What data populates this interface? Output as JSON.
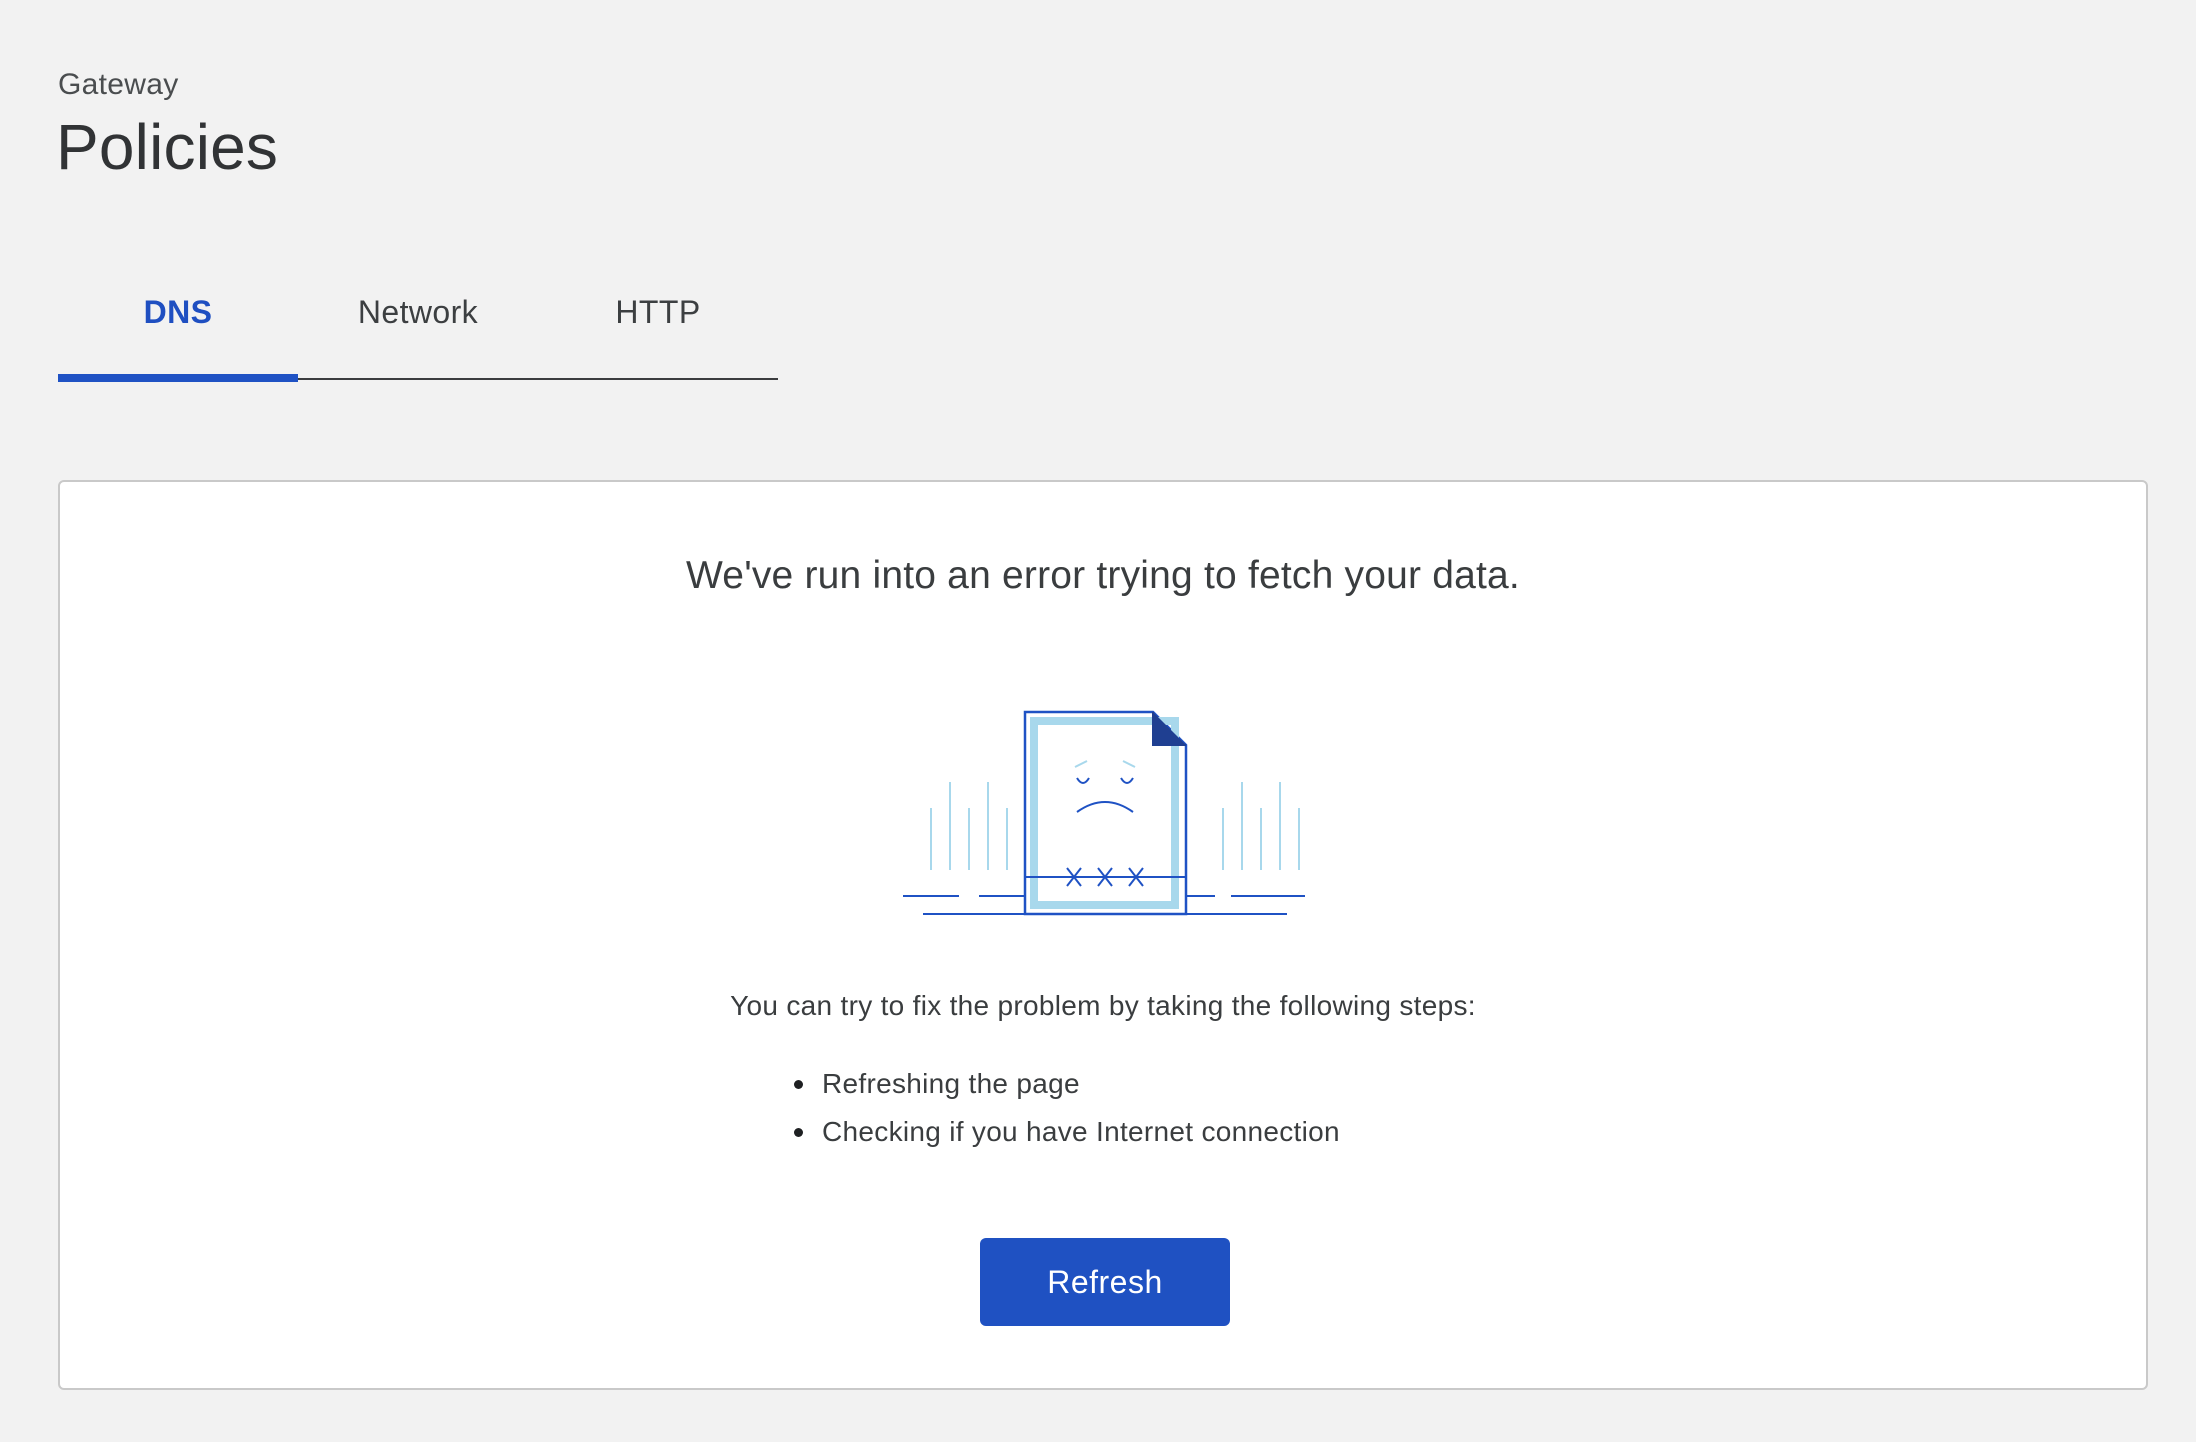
{
  "header": {
    "breadcrumb": "Gateway",
    "title": "Policies"
  },
  "tabs": [
    {
      "label": "DNS",
      "active": true
    },
    {
      "label": "Network",
      "active": false
    },
    {
      "label": "HTTP",
      "active": false
    }
  ],
  "error": {
    "heading": "We've run into an error trying to fetch your data.",
    "illustration_icon": "sad-document-icon",
    "steps_intro": "You can try to fix the problem by taking the following steps:",
    "steps": [
      "Refreshing the page",
      "Checking if you have Internet connection"
    ],
    "refresh_label": "Refresh"
  },
  "colors": {
    "accent": "#1f52c4",
    "page_background": "#f2f2f2",
    "card_background": "#ffffff",
    "illustration_light": "#a8d8ec",
    "illustration_dark": "#1f52c4"
  }
}
